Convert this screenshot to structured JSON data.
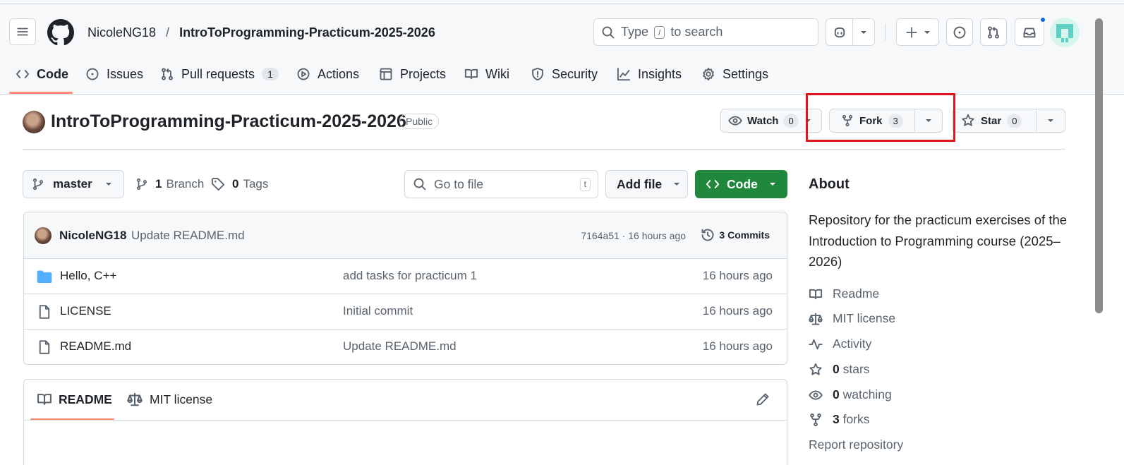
{
  "header": {
    "owner": "NicoleNG18",
    "separator": "/",
    "repo": "IntroToProgramming-Practicum-2025-2026",
    "search": {
      "prefix": "Type",
      "key": "/",
      "suffix": "to search"
    }
  },
  "tabs": [
    {
      "label": "Code",
      "icon": "code-icon"
    },
    {
      "label": "Issues",
      "icon": "issue-icon"
    },
    {
      "label": "Pull requests",
      "icon": "pull-request-icon",
      "count": "1"
    },
    {
      "label": "Actions",
      "icon": "play-icon"
    },
    {
      "label": "Projects",
      "icon": "table-icon"
    },
    {
      "label": "Wiki",
      "icon": "book-icon"
    },
    {
      "label": "Security",
      "icon": "shield-icon"
    },
    {
      "label": "Insights",
      "icon": "graph-icon"
    },
    {
      "label": "Settings",
      "icon": "gear-icon"
    }
  ],
  "repo_header": {
    "title": "IntroToProgramming-Practicum-2025-2026",
    "visibility": "Public",
    "watch": {
      "label": "Watch",
      "count": "0"
    },
    "fork": {
      "label": "Fork",
      "count": "3"
    },
    "star": {
      "label": "Star",
      "count": "0"
    }
  },
  "toolbar": {
    "branch": "master",
    "branches_count": "1",
    "branches_label": "Branch",
    "tags_count": "0",
    "tags_label": "Tags",
    "go_to_file": "Go to file",
    "go_to_file_key": "t",
    "add_file": "Add file",
    "code": "Code"
  },
  "commit": {
    "author": "NicoleNG18",
    "message": "Update README.md",
    "hash_time": "7164a51 · 16 hours ago",
    "commits": "3 Commits"
  },
  "files": [
    {
      "name": "Hello, C++",
      "type": "folder",
      "message": "add tasks for practicum 1",
      "time": "16 hours ago"
    },
    {
      "name": "LICENSE",
      "type": "file",
      "message": "Initial commit",
      "time": "16 hours ago"
    },
    {
      "name": "README.md",
      "type": "file",
      "message": "Update README.md",
      "time": "16 hours ago"
    }
  ],
  "readme_tabs": {
    "readme": "README",
    "license": "MIT license"
  },
  "about": {
    "heading": "About",
    "description": "Repository for the practicum exercises of the Introduction to Programming course (2025–2026)",
    "readme": "Readme",
    "license": "MIT license",
    "activity": "Activity",
    "stars_count": "0",
    "stars_label": "stars",
    "watching_count": "0",
    "watching_label": "watching",
    "forks_count": "3",
    "forks_label": "forks",
    "report": "Report repository"
  },
  "colors": {
    "accent_underline": "#fd8c73",
    "code_button": "#1f883d",
    "highlight_box": "#e0161d",
    "folder": "#54aeff",
    "notification_dot": "#0969da"
  }
}
